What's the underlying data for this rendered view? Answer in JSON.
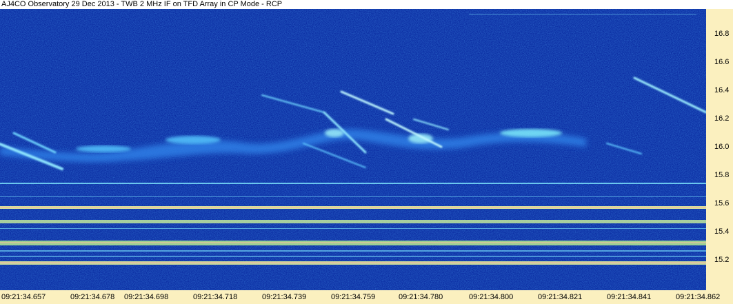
{
  "title": "AJ4CO Observatory 29 Dec 2013 - TWB 2 MHz IF on TFD Array in CP Mode - RCP",
  "y_axis": {
    "ticks": [
      "16.8",
      "16.6",
      "16.4",
      "16.2",
      "16.0",
      "15.8",
      "15.6",
      "15.4",
      "15.2"
    ]
  },
  "x_axis": {
    "ticks": [
      "09:21:34.657",
      "09:21:34.678",
      "09:21:34.698",
      "09:21:34.718",
      "09:21:34.739",
      "09:21:34.759",
      "09:21:34.780",
      "09:21:34.800",
      "09:21:34.821",
      "09:21:34.841",
      "09:21:34.862"
    ]
  },
  "colors": {
    "background": "#0a2a9c",
    "axis_background": "#fbf0bf",
    "emission": "#58d6ff",
    "interference": "#f2ff9a"
  }
}
